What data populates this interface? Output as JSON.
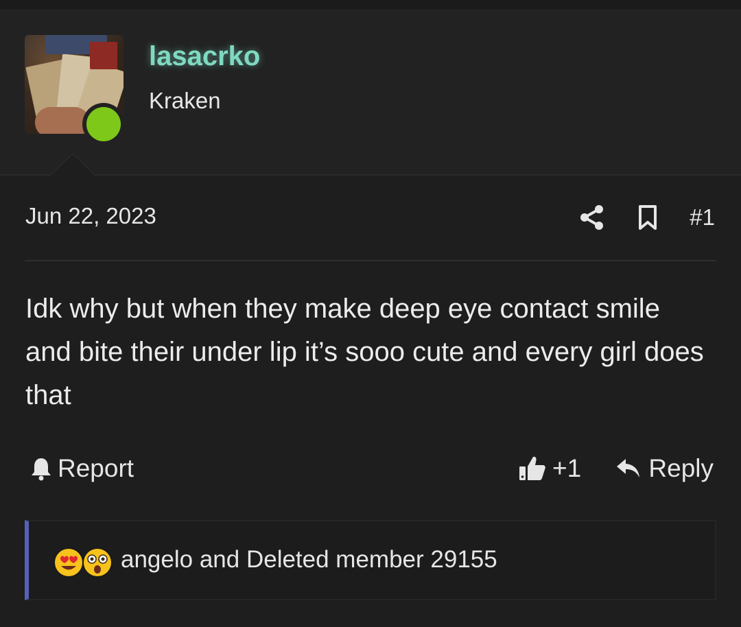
{
  "user": {
    "username": "lasacrko",
    "title": "Kraken",
    "online_color": "#7ec81a",
    "username_color": "#7fd9c1"
  },
  "post": {
    "date": "Jun 22, 2023",
    "number": "#1",
    "body": "Idk why but when they make deep eye contact smile and bite their under lip it’s sooo cute and every girl does that"
  },
  "actions": {
    "report_label": "Report",
    "like_count": "+1",
    "reply_label": "Reply"
  },
  "icons": {
    "share": "share-icon",
    "bookmark": "bookmark-icon",
    "report": "bell-icon",
    "like": "thumbs-up-icon",
    "reply": "reply-arrow-icon",
    "reactions": [
      "heart-eyes-emoji",
      "astonished-emoji"
    ]
  },
  "reactions": {
    "text": "angelo and Deleted member 29155",
    "accent_color": "#5561b8"
  }
}
